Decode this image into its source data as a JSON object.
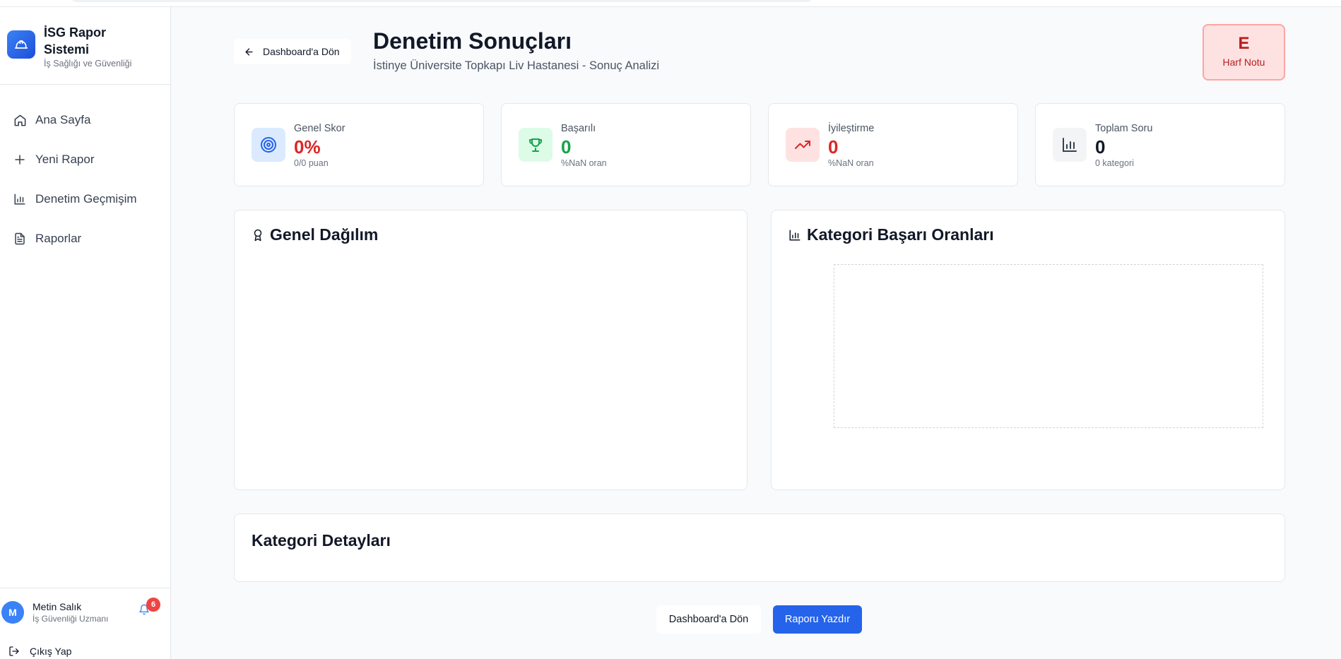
{
  "sidebar": {
    "brand_title": "İSG Rapor Sistemi",
    "brand_subtitle": "İş Sağlığı ve Güvenliği",
    "items": [
      {
        "label": "Ana Sayfa",
        "icon": "home-icon"
      },
      {
        "label": "Yeni Rapor",
        "icon": "plus-icon"
      },
      {
        "label": "Denetim Geçmişim",
        "icon": "bar-chart-icon"
      },
      {
        "label": "Raporlar",
        "icon": "file-text-icon"
      }
    ],
    "user": {
      "initial": "M",
      "name": "Metin Salık",
      "role": "İş Güvenliği Uzmanı",
      "notifications": "6"
    },
    "logout_label": "Çıkış Yap"
  },
  "header": {
    "back_label": "Dashboard'a Dön",
    "title": "Denetim Sonuçları",
    "subtitle": "İstinye Üniversite Topkapı Liv Hastanesi - Sonuç Analizi",
    "grade_letter": "E",
    "grade_label": "Harf Notu"
  },
  "stats": [
    {
      "label": "Genel Skor",
      "value": "0%",
      "sub": "0/0 puan",
      "icon": "target-icon",
      "color": "#dc2626"
    },
    {
      "label": "Başarılı",
      "value": "0",
      "sub": "%NaN oran",
      "icon": "trophy-icon",
      "color": "#16a34a"
    },
    {
      "label": "İyileştirme",
      "value": "0",
      "sub": "%NaN oran",
      "icon": "trending-up-icon",
      "color": "#dc2626"
    },
    {
      "label": "Toplam Soru",
      "value": "0",
      "sub": "0 kategori",
      "icon": "bar-chart-icon",
      "color": "#111827"
    }
  ],
  "panels": {
    "distribution_title": "Genel Dağılım",
    "category_rates_title": "Kategori Başarı Oranları",
    "category_details_title": "Kategori Detayları"
  },
  "actions": {
    "back_label": "Dashboard'a Dön",
    "print_label": "Raporu Yazdır"
  },
  "colors": {
    "accent": "#2563eb",
    "danger": "#dc2626",
    "success": "#16a34a"
  }
}
